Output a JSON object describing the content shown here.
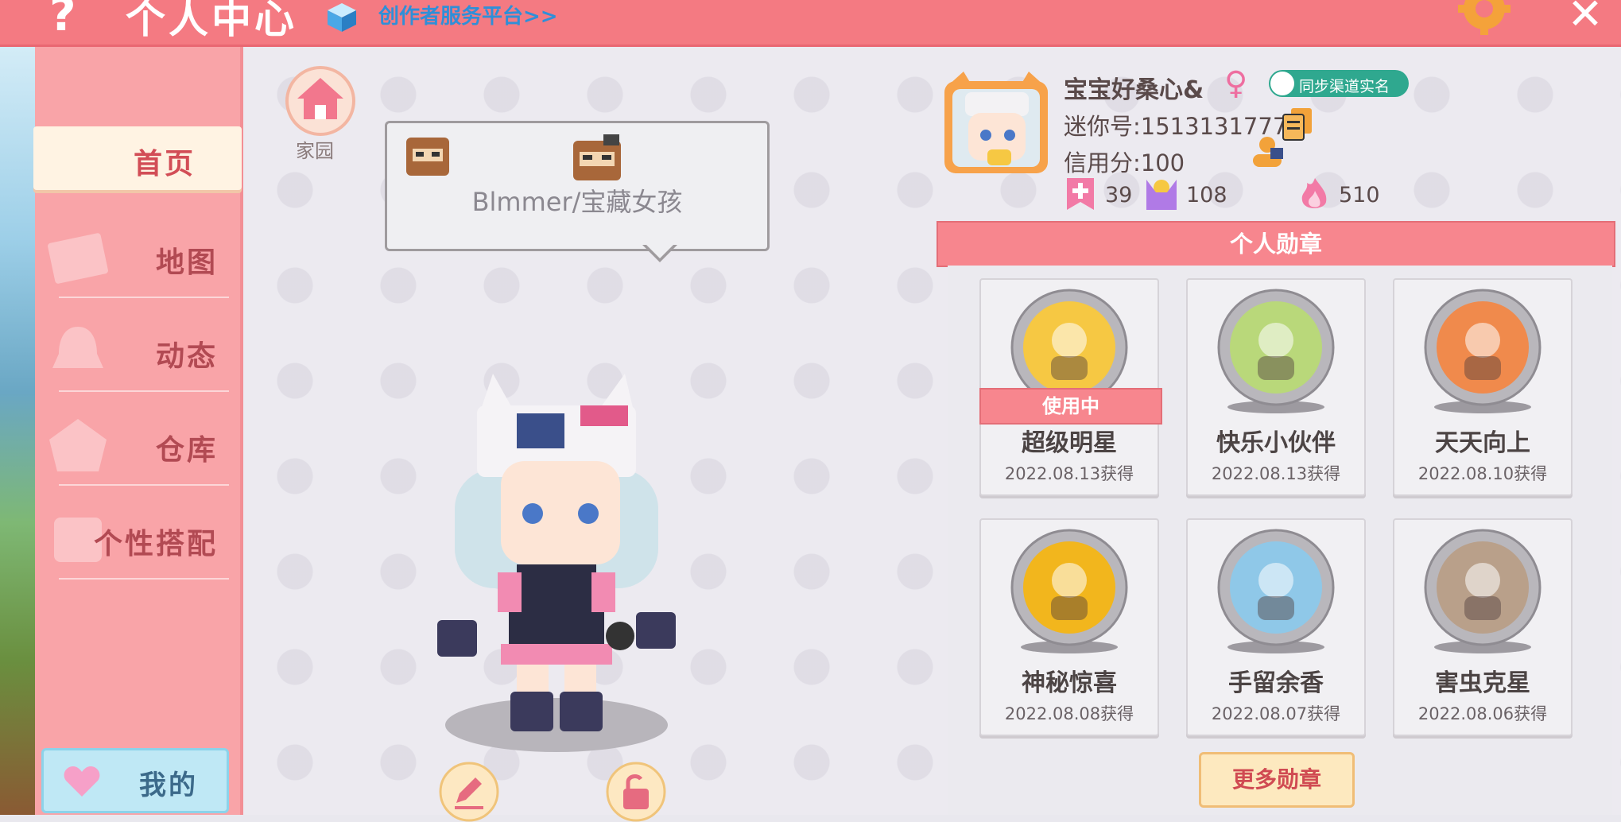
{
  "header": {
    "title": "个人中心",
    "help_glyph": "?",
    "creator_link": "创作者服务平台>>",
    "close_glyph": "✕"
  },
  "sidebar": {
    "items": [
      {
        "label": "首页",
        "icon": "home-tab-icon",
        "active": true
      },
      {
        "label": "地图",
        "icon": "map-icon"
      },
      {
        "label": "动态",
        "icon": "bell-icon"
      },
      {
        "label": "仓库",
        "icon": "warehouse-icon"
      },
      {
        "label": "个性搭配",
        "icon": "outfit-icon"
      }
    ],
    "my_button": "我的"
  },
  "center": {
    "home_label": "家园",
    "bubble_text": "Blmmer/宝藏女孩"
  },
  "profile": {
    "username": "宝宝好桑心&",
    "gender_glyph": "♀",
    "sync_badge": "同步渠道实名",
    "mini_id": "迷你号:1513131777",
    "credit": "信用分:100",
    "stats": [
      {
        "icon": "plus-flag-icon",
        "value": "39"
      },
      {
        "icon": "cheer-icon",
        "value": "108"
      },
      {
        "icon": "flame-icon",
        "value": "510"
      }
    ]
  },
  "medals": {
    "title": "个人勋章",
    "in_use_label": "使用中",
    "items": [
      {
        "name": "超级明星",
        "date": "2022.08.13获得",
        "in_use": true,
        "theme": "#f6c843"
      },
      {
        "name": "快乐小伙伴",
        "date": "2022.08.13获得",
        "in_use": false,
        "theme": "#b9d87a"
      },
      {
        "name": "天天向上",
        "date": "2022.08.10获得",
        "in_use": false,
        "theme": "#f08a4c"
      },
      {
        "name": "神秘惊喜",
        "date": "2022.08.08获得",
        "in_use": false,
        "theme": "#f2b61d"
      },
      {
        "name": "手留余香",
        "date": "2022.08.07获得",
        "in_use": false,
        "theme": "#8fc8e8"
      },
      {
        "name": "害虫克星",
        "date": "2022.08.06获得",
        "in_use": false,
        "theme": "#b9a08a"
      }
    ],
    "more_button": "更多勋章"
  },
  "colors": {
    "accent": "#f47a82",
    "sidebar": "#f9a4a8",
    "link": "#2f8fd8"
  }
}
